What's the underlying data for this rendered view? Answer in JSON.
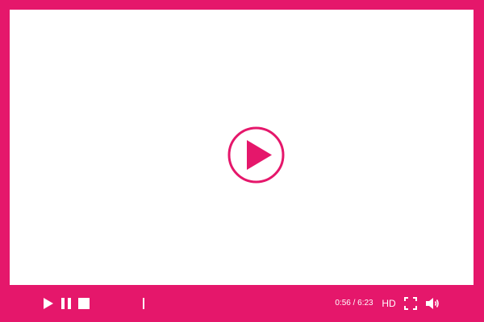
{
  "player": {
    "accent_color": "#e5176b",
    "screen_color": "#ffffff",
    "center_button_icon": "play-circle-icon",
    "controls": {
      "play_icon": "play-icon",
      "pause_icon": "pause-icon",
      "stop_icon": "stop-icon",
      "time_display": "0:56 / 6:23",
      "quality_label": "HD",
      "fullscreen_icon": "fullscreen-icon",
      "volume_icon": "volume-icon"
    },
    "progress": {
      "current_seconds": 56,
      "duration_seconds": 383
    }
  }
}
